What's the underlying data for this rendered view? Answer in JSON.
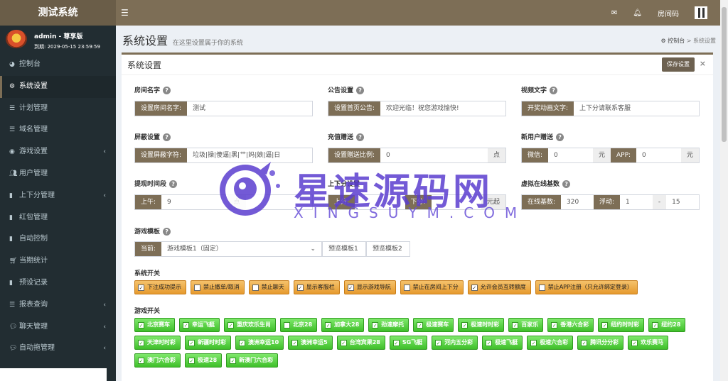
{
  "app": {
    "brand": "测试系统",
    "menu_icon": "hamburger-icon"
  },
  "topbar": {
    "mail_icon": "mail-icon",
    "bell_icon": "bell-icon",
    "room_label": "房间码",
    "qr_icon": "qr-code-icon"
  },
  "user": {
    "name": "admin - 尊享版",
    "expires": "到期: 2029-05-15 23:59:59"
  },
  "sidebar": {
    "items": [
      {
        "label": "控制台",
        "icon": "dashboard-icon",
        "active": false,
        "has_arrow": false
      },
      {
        "label": "系统设置",
        "icon": "cogs-icon",
        "active": true,
        "has_arrow": false
      },
      {
        "label": "计划管理",
        "icon": "list-icon",
        "active": false,
        "has_arrow": false
      },
      {
        "label": "域名管理",
        "icon": "list-icon",
        "active": false,
        "has_arrow": false
      },
      {
        "label": "游戏设置",
        "icon": "gamepad-icon",
        "active": false,
        "has_arrow": true
      },
      {
        "label": "用户管理",
        "icon": "users-icon",
        "active": false,
        "has_arrow": false
      },
      {
        "label": "上下分管理",
        "icon": "file-icon",
        "active": false,
        "has_arrow": true
      },
      {
        "label": "红包管理",
        "icon": "file-icon",
        "active": false,
        "has_arrow": false
      },
      {
        "label": "自动控制",
        "icon": "file-icon",
        "active": false,
        "has_arrow": false
      },
      {
        "label": "当期统计",
        "icon": "cart-icon",
        "active": false,
        "has_arrow": false
      },
      {
        "label": "预设记录",
        "icon": "file-icon",
        "active": false,
        "has_arrow": false
      },
      {
        "label": "报表查询",
        "icon": "list-icon",
        "active": false,
        "has_arrow": true
      },
      {
        "label": "聊天管理",
        "icon": "comments-icon",
        "active": false,
        "has_arrow": true
      },
      {
        "label": "自动拖管理",
        "icon": "comment-icon",
        "active": false,
        "has_arrow": true
      }
    ]
  },
  "header": {
    "title": "系统设置",
    "subtitle": "在这里设置属于你的系统",
    "crumb_home": "控制台",
    "crumb_sep": ">",
    "crumb_current": "系统设置"
  },
  "box": {
    "title": "系统设置",
    "save_label": "保存设置",
    "close": "×"
  },
  "form": {
    "room_name": {
      "label": "房间名字",
      "addon": "设置房间名字:",
      "value": "测试"
    },
    "notice": {
      "label": "公告设置",
      "addon": "设置首页公告:",
      "value": "欢迎光临！祝您游戏愉快!"
    },
    "video_text": {
      "label": "视频文字",
      "addon": "开奖动画文字:",
      "value": "上下分请联系客服"
    },
    "shield": {
      "label": "屏蔽设置",
      "addon": "设置屏蔽字符:",
      "value": "垃圾|操|傻逼|黑|艹|妈|娘|逼|日"
    },
    "recharge": {
      "label": "充值赠送",
      "addon": "设置赠送比例:",
      "value": "0",
      "unit": "点"
    },
    "new_user": {
      "label": "新用户赠送",
      "wechat_addon": "微信:",
      "wechat_value": "0",
      "wechat_unit": "元",
      "app_addon": "APP:",
      "app_value": "0",
      "app_unit": "元"
    },
    "withdraw": {
      "label": "提现时间段",
      "am_addon": "上午:",
      "am_value": "9",
      "am_unit": "点"
    },
    "updown": {
      "label": "上下分设置",
      "up_addon": "上分:",
      "down_addon": "下分:",
      "unit": "元起"
    },
    "online": {
      "label": "虚拟在线基数",
      "base_addon": "在线基数:",
      "base_value": "320",
      "float_addon": "浮动:",
      "float_min": "1",
      "dash": "-",
      "float_max": "15"
    },
    "template": {
      "label": "游戏模板",
      "addon": "当前:",
      "selected": "游戏模板1（固定）",
      "preview1": "预览模板1",
      "preview2": "预览模板2"
    }
  },
  "system_switches": {
    "label": "系统开关",
    "items": [
      {
        "label": "下注成功提示",
        "checked": true
      },
      {
        "label": "禁止撤单/取消",
        "checked": false
      },
      {
        "label": "禁止聊天",
        "checked": false
      },
      {
        "label": "显示客服栏",
        "checked": true
      },
      {
        "label": "显示游戏导航",
        "checked": true
      },
      {
        "label": "禁止在房间上下分",
        "checked": false
      },
      {
        "label": "允许会员互转额度",
        "checked": true
      },
      {
        "label": "禁止APP注册（只允许绑定登录）",
        "checked": false
      }
    ]
  },
  "game_switches": {
    "label": "游戏开关",
    "items": [
      {
        "label": "北京赛车",
        "checked": true
      },
      {
        "label": "幸运飞艇",
        "checked": true
      },
      {
        "label": "重庆欢乐生肖",
        "checked": true
      },
      {
        "label": "北京28",
        "checked": false
      },
      {
        "label": "加拿大28",
        "checked": true
      },
      {
        "label": "劲速摩托",
        "checked": true
      },
      {
        "label": "极速赛车",
        "checked": true
      },
      {
        "label": "极速时时彩",
        "checked": true
      },
      {
        "label": "百家乐",
        "checked": true
      },
      {
        "label": "香港六合彩",
        "checked": true
      },
      {
        "label": "纽约时时彩",
        "checked": true
      },
      {
        "label": "纽约28",
        "checked": true
      },
      {
        "label": "天津时时彩",
        "checked": true
      },
      {
        "label": "新疆时时彩",
        "checked": true
      },
      {
        "label": "澳洲幸运10",
        "checked": true
      },
      {
        "label": "澳洲幸运5",
        "checked": true
      },
      {
        "label": "台湾宾果28",
        "checked": true
      },
      {
        "label": "SG飞艇",
        "checked": true
      },
      {
        "label": "河内五分彩",
        "checked": true
      },
      {
        "label": "极速飞艇",
        "checked": true
      },
      {
        "label": "极速六合彩",
        "checked": true
      },
      {
        "label": "腾讯分分彩",
        "checked": true
      },
      {
        "label": "欢乐赛马",
        "checked": true
      },
      {
        "label": "澳门六合彩",
        "checked": true
      },
      {
        "label": "极速28",
        "checked": true
      },
      {
        "label": "新澳门六合彩",
        "checked": true
      }
    ]
  },
  "watermark": {
    "title": "星速源码网",
    "subtitle": "XINGSUYM.COM"
  },
  "colors": {
    "accent": "#7d6e56",
    "sidebar": "#222d32",
    "orange": "#e69a2e",
    "green": "#3fbf2a",
    "watermark": "#5b3ecf"
  }
}
